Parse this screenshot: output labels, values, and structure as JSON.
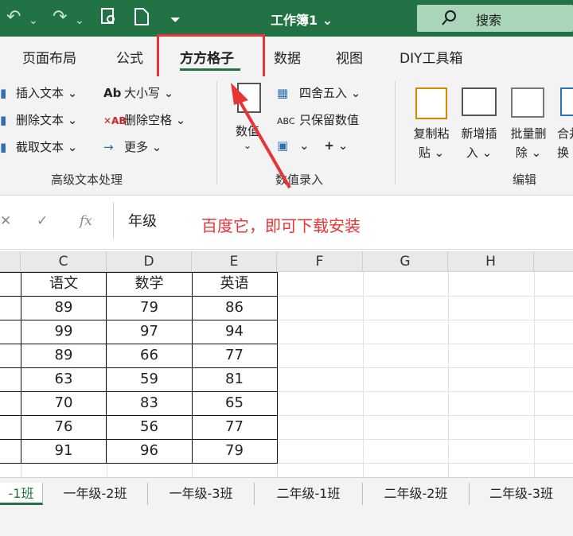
{
  "titlebar": {
    "title": "工作簿1",
    "title_caret": "⌄",
    "search_label": "搜索"
  },
  "tabs": [
    {
      "label": "页面布局"
    },
    {
      "label": "公式"
    },
    {
      "label": "方方格子",
      "active": true
    },
    {
      "label": "数据"
    },
    {
      "label": "视图"
    },
    {
      "label": "DIY工具箱"
    }
  ],
  "ribbon": {
    "group1": {
      "items": [
        "插入文本",
        "删除文本",
        "截取文本"
      ],
      "items2": [
        "大小写",
        "删除空格",
        "更多"
      ],
      "label": "高级文本处理"
    },
    "group2": {
      "big_label": "数值",
      "items": [
        "四舍五入",
        "只保留数值"
      ],
      "label": "数值录入"
    },
    "group3": {
      "buttons": [
        {
          "line1": "复制粘",
          "line2": "贴"
        },
        {
          "line1": "新增插",
          "line2": "入"
        },
        {
          "line1": "批量删",
          "line2": "除"
        },
        {
          "line1": "合并",
          "line2": "换"
        }
      ],
      "label": "编辑"
    }
  },
  "formula": {
    "fx": "fx",
    "value": "年级",
    "annotation": "百度它，即可下载安装"
  },
  "columns": [
    "C",
    "D",
    "E",
    "F",
    "G",
    "H"
  ],
  "table": {
    "headers": [
      "语文",
      "数学",
      "英语"
    ],
    "rows": [
      [
        "89",
        "79",
        "86"
      ],
      [
        "99",
        "97",
        "94"
      ],
      [
        "89",
        "66",
        "77"
      ],
      [
        "63",
        "59",
        "81"
      ],
      [
        "70",
        "83",
        "65"
      ],
      [
        "76",
        "56",
        "77"
      ],
      [
        "91",
        "96",
        "79"
      ]
    ]
  },
  "sheets": [
    "-1班",
    "一年级-2班",
    "一年级-3班",
    "二年级-1班",
    "二年级-2班",
    "二年级-3班"
  ],
  "colors": {
    "accent": "#217346",
    "highlight": "#e83434"
  }
}
